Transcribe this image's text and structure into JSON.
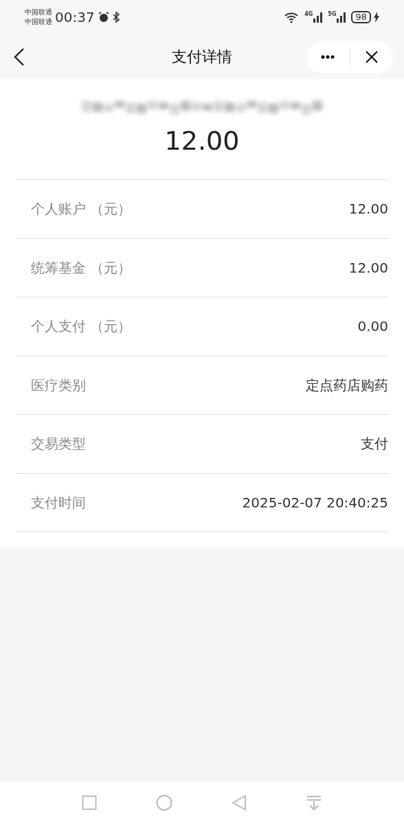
{
  "status_bar": {
    "carriers": [
      "中国联通",
      "中国联通"
    ],
    "time": "00:37",
    "networks": [
      "4G",
      "5G"
    ],
    "battery": "98"
  },
  "header": {
    "title": "支付详情"
  },
  "summary": {
    "amount": "12.00"
  },
  "rows": [
    {
      "label": "个人账户 （元）",
      "value": "12.00"
    },
    {
      "label": "统筹基金 （元）",
      "value": "12.00"
    },
    {
      "label": "个人支付 （元）",
      "value": "0.00"
    },
    {
      "label": "医疗类别",
      "value": "定点药店购药"
    },
    {
      "label": "交易类型",
      "value": "支付"
    },
    {
      "label": "支付时间",
      "value": "2025-02-07 20:40:25"
    }
  ]
}
